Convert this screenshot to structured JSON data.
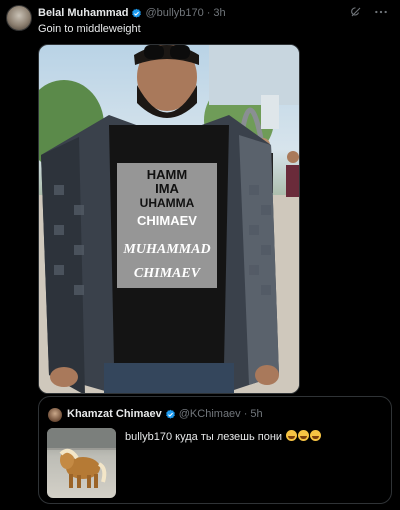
{
  "tweet": {
    "author_name": "Belal Muhammad",
    "handle": "@bullyb170",
    "separator": "·",
    "time": "3h",
    "text": "Goin to middleweight",
    "photo_shirt_text": [
      "HAMM",
      "IMA",
      "UHAMMA",
      "CHIMAEV",
      "MUHAMMAD",
      "CHIMAEV"
    ]
  },
  "quoted_tweet": {
    "author_name": "Khamzat Chimaev",
    "handle": "@KChimaev",
    "separator": "·",
    "time": "5h",
    "text": "bullyb170 куда ты лезешь пони"
  },
  "icons": {
    "verified": "verified-badge-icon",
    "grok": "grok-icon",
    "more": "more-icon",
    "emoji": "tears-of-joy-emoji"
  },
  "colors": {
    "verified": "#1d9bf0",
    "muted": "#71767b",
    "border": "#2f3336"
  }
}
